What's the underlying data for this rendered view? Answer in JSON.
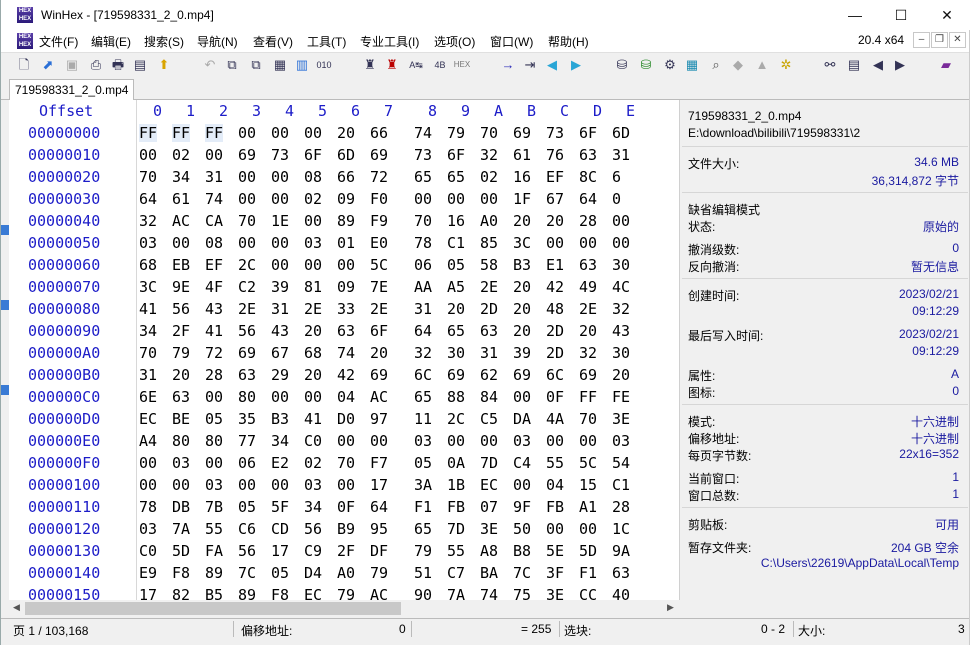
{
  "window": {
    "app_name": "WinHex",
    "title": "WinHex - [719598331_2_0.mp4]",
    "minimize": "—",
    "maximize": "☐",
    "close": "✕"
  },
  "menu": {
    "items": [
      "文件(F)",
      "编辑(E)",
      "搜索(S)",
      "导航(N)",
      "查看(V)",
      "工具(T)",
      "专业工具(I)",
      "选项(O)",
      "窗口(W)",
      "帮助(H)"
    ],
    "zoom": "20.4 x64"
  },
  "tab": {
    "label": "719598331_2_0.mp4"
  },
  "hex": {
    "offset_header": "Offset",
    "columns": [
      "0",
      "1",
      "2",
      "3",
      "4",
      "5",
      "6",
      "7",
      "8",
      "9",
      "A",
      "B",
      "C",
      "D",
      "E"
    ],
    "rows": [
      {
        "offset": "00000000",
        "bytes": [
          "FF",
          "FF",
          "FF",
          "00",
          "00",
          "00",
          "20",
          "66",
          "74",
          "79",
          "70",
          "69",
          "73",
          "6F",
          "6D"
        ]
      },
      {
        "offset": "00000010",
        "bytes": [
          "00",
          "02",
          "00",
          "69",
          "73",
          "6F",
          "6D",
          "69",
          "73",
          "6F",
          "32",
          "61",
          "76",
          "63",
          "31"
        ]
      },
      {
        "offset": "00000020",
        "bytes": [
          "70",
          "34",
          "31",
          "00",
          "00",
          "08",
          "66",
          "72",
          "65",
          "65",
          "02",
          "16",
          "EF",
          "8C",
          "6"
        ]
      },
      {
        "offset": "00000030",
        "bytes": [
          "64",
          "61",
          "74",
          "00",
          "00",
          "02",
          "09",
          "F0",
          "00",
          "00",
          "00",
          "1F",
          "67",
          "64",
          "0"
        ]
      },
      {
        "offset": "00000040",
        "bytes": [
          "32",
          "AC",
          "CA",
          "70",
          "1E",
          "00",
          "89",
          "F9",
          "70",
          "16",
          "A0",
          "20",
          "20",
          "28",
          "00"
        ]
      },
      {
        "offset": "00000050",
        "bytes": [
          "03",
          "00",
          "08",
          "00",
          "00",
          "03",
          "01",
          "E0",
          "78",
          "C1",
          "85",
          "3C",
          "00",
          "00",
          "00"
        ]
      },
      {
        "offset": "00000060",
        "bytes": [
          "68",
          "EB",
          "EF",
          "2C",
          "00",
          "00",
          "00",
          "5C",
          "06",
          "05",
          "58",
          "B3",
          "E1",
          "63",
          "30"
        ]
      },
      {
        "offset": "00000070",
        "bytes": [
          "3C",
          "9E",
          "4F",
          "C2",
          "39",
          "81",
          "09",
          "7E",
          "AA",
          "A5",
          "2E",
          "20",
          "42",
          "49",
          "4C"
        ]
      },
      {
        "offset": "00000080",
        "bytes": [
          "41",
          "56",
          "43",
          "2E",
          "31",
          "2E",
          "33",
          "2E",
          "31",
          "20",
          "2D",
          "20",
          "48",
          "2E",
          "32"
        ]
      },
      {
        "offset": "00000090",
        "bytes": [
          "34",
          "2F",
          "41",
          "56",
          "43",
          "20",
          "63",
          "6F",
          "64",
          "65",
          "63",
          "20",
          "2D",
          "20",
          "43"
        ]
      },
      {
        "offset": "000000A0",
        "bytes": [
          "70",
          "79",
          "72",
          "69",
          "67",
          "68",
          "74",
          "20",
          "32",
          "30",
          "31",
          "39",
          "2D",
          "32",
          "30"
        ]
      },
      {
        "offset": "000000B0",
        "bytes": [
          "31",
          "20",
          "28",
          "63",
          "29",
          "20",
          "42",
          "69",
          "6C",
          "69",
          "62",
          "69",
          "6C",
          "69",
          "20"
        ]
      },
      {
        "offset": "000000C0",
        "bytes": [
          "6E",
          "63",
          "00",
          "80",
          "00",
          "00",
          "04",
          "AC",
          "65",
          "88",
          "84",
          "00",
          "0F",
          "FF",
          "FE"
        ]
      },
      {
        "offset": "000000D0",
        "bytes": [
          "EC",
          "BE",
          "05",
          "35",
          "B3",
          "41",
          "D0",
          "97",
          "11",
          "2C",
          "C5",
          "DA",
          "4A",
          "70",
          "3E"
        ]
      },
      {
        "offset": "000000E0",
        "bytes": [
          "A4",
          "80",
          "80",
          "77",
          "34",
          "C0",
          "00",
          "00",
          "03",
          "00",
          "00",
          "03",
          "00",
          "00",
          "03"
        ]
      },
      {
        "offset": "000000F0",
        "bytes": [
          "00",
          "03",
          "00",
          "06",
          "E2",
          "02",
          "70",
          "F7",
          "05",
          "0A",
          "7D",
          "C4",
          "55",
          "5C",
          "54"
        ]
      },
      {
        "offset": "00000100",
        "bytes": [
          "00",
          "00",
          "03",
          "00",
          "00",
          "03",
          "00",
          "17",
          "3A",
          "1B",
          "EC",
          "00",
          "04",
          "15",
          "C1"
        ]
      },
      {
        "offset": "00000110",
        "bytes": [
          "78",
          "DB",
          "7B",
          "05",
          "5F",
          "34",
          "0F",
          "64",
          "F1",
          "FB",
          "07",
          "9F",
          "FB",
          "A1",
          "28"
        ]
      },
      {
        "offset": "00000120",
        "bytes": [
          "03",
          "7A",
          "55",
          "C6",
          "CD",
          "56",
          "B9",
          "95",
          "65",
          "7D",
          "3E",
          "50",
          "00",
          "00",
          "1C"
        ]
      },
      {
        "offset": "00000130",
        "bytes": [
          "C0",
          "5D",
          "FA",
          "56",
          "17",
          "C9",
          "2F",
          "DF",
          "79",
          "55",
          "A8",
          "B8",
          "5E",
          "5D",
          "9A"
        ]
      },
      {
        "offset": "00000140",
        "bytes": [
          "E9",
          "F8",
          "89",
          "7C",
          "05",
          "D4",
          "A0",
          "79",
          "51",
          "C7",
          "BA",
          "7C",
          "3F",
          "F1",
          "63"
        ]
      },
      {
        "offset": "00000150",
        "bytes": [
          "17",
          "82",
          "B5",
          "89",
          "F8",
          "EC",
          "79",
          "AC",
          "90",
          "7A",
          "74",
          "75",
          "3E",
          "CC",
          "40"
        ]
      }
    ]
  },
  "info": {
    "filename": "719598331_2_0.mp4",
    "path": "E:\\download\\bilibili\\719598331\\2",
    "file_size_label": "文件大小:",
    "file_size_mb": "34.6 MB",
    "file_size_bytes": "36,314,872 字节",
    "default_edit_mode": "缺省编辑模式",
    "state_label": "状态:",
    "state_value": "原始的",
    "undo_level_label": "撤消级数:",
    "undo_level_value": "0",
    "reverse_undo_label": "反向撤消:",
    "reverse_undo_value": "暂无信息",
    "created_label": "创建时间:",
    "created_date": "2023/02/21",
    "created_time": "09:12:29",
    "modified_label": "最后写入时间:",
    "modified_date": "2023/02/21",
    "modified_time": "09:12:29",
    "attr_label": "属性:",
    "attr_value": "A",
    "icon_label": "图标:",
    "icon_value": "0",
    "mode_label": "模式:",
    "mode_value": "十六进制",
    "offset_addr_label": "偏移地址:",
    "offset_addr_value": "十六进制",
    "bytes_per_page_label": "每页字节数:",
    "bytes_per_page_value": "22x16=352",
    "current_window_label": "当前窗口:",
    "current_window_value": "1",
    "total_windows_label": "窗口总数:",
    "total_windows_value": "1",
    "clipboard_label": "剪贴板:",
    "clipboard_value": "可用",
    "temp_folder_label": "暂存文件夹:",
    "temp_folder_free": "204 GB 空余",
    "temp_folder_path": "C:\\Users\\22619\\AppData\\Local\\Temp"
  },
  "status": {
    "page": "页 1 / 103,168",
    "offset_label": "偏移地址:",
    "offset_value": "0",
    "value": "= 255",
    "selection_label": "选块:",
    "selection_value": "0 - 2",
    "size_label": "大小:",
    "size_value": "3"
  },
  "colors": {
    "hex_header": "#1c1cc8",
    "info_value": "#1a1aa0",
    "selection": "#e3ecf8"
  }
}
